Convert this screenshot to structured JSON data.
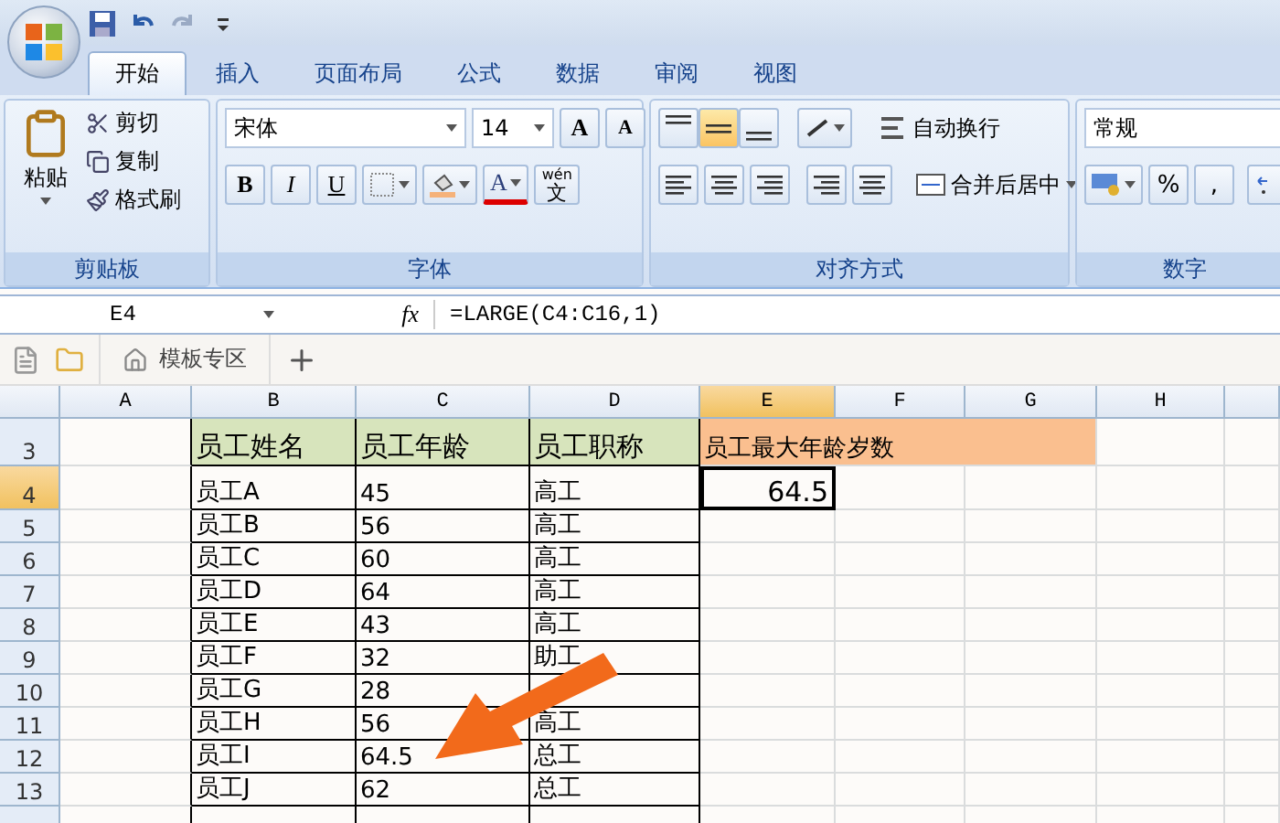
{
  "tabs": [
    {
      "label": "开始",
      "selected": true
    },
    {
      "label": "插入",
      "selected": false
    },
    {
      "label": "页面布局",
      "selected": false
    },
    {
      "label": "公式",
      "selected": false
    },
    {
      "label": "数据",
      "selected": false
    },
    {
      "label": "审阅",
      "selected": false
    },
    {
      "label": "视图",
      "selected": false
    }
  ],
  "clipboard": {
    "title": "剪贴板",
    "paste": "粘贴",
    "items": [
      "剪切",
      "复制",
      "格式刷"
    ]
  },
  "font": {
    "title": "字体",
    "name": "宋体",
    "size": "14",
    "grow": "A",
    "shrink": "A",
    "styles": [
      "B",
      "I",
      "U"
    ],
    "color_letter": "A",
    "phonetic_top": "wén",
    "phonetic_char": "文"
  },
  "alignment": {
    "title": "对齐方式",
    "vertical": [
      {
        "selected": false
      },
      {
        "selected": true
      },
      {
        "selected": false
      }
    ],
    "wrap": "自动换行",
    "merge": "合并后居中"
  },
  "number": {
    "title": "数字",
    "format": "常规",
    "symbols": [
      "%",
      ","
    ]
  },
  "formula_bar": {
    "cell_ref": "E4",
    "fx": "fx",
    "formula": "=LARGE(C4:C16,1)"
  },
  "doc_tabs": [
    {
      "label": "模板专区"
    }
  ],
  "columns": [
    {
      "label": "A",
      "selected": false
    },
    {
      "label": "B",
      "selected": false
    },
    {
      "label": "C",
      "selected": false
    },
    {
      "label": "D",
      "selected": false
    },
    {
      "label": "E",
      "selected": true
    },
    {
      "label": "F",
      "selected": false
    },
    {
      "label": "G",
      "selected": false
    },
    {
      "label": "H",
      "selected": false
    }
  ],
  "rows": [
    {
      "number": "3",
      "selected": false,
      "cells": [
        null,
        {
          "text": "员工姓名",
          "kind": "header",
          "color": "#d7e4bc"
        },
        {
          "text": "员工年龄",
          "kind": "header",
          "color": "#d7e4bc"
        },
        {
          "text": "员工职称",
          "kind": "header",
          "color": "#d7e4bc"
        },
        {
          "text": "员工最大年龄岁数",
          "kind": "wide-header",
          "color": "#fabf8f"
        }
      ]
    },
    {
      "number": "4",
      "selected": true,
      "cells": [
        null,
        {
          "text": "员工A",
          "kind": "data"
        },
        {
          "text": "45",
          "kind": "data"
        },
        {
          "text": "高工",
          "kind": "data"
        },
        {
          "text": "64.5",
          "kind": "result",
          "selected": true
        }
      ]
    },
    {
      "number": "5",
      "selected": false,
      "cells": [
        null,
        {
          "text": "员工B",
          "kind": "data"
        },
        {
          "text": "56",
          "kind": "data"
        },
        {
          "text": "高工",
          "kind": "data"
        }
      ]
    },
    {
      "number": "6",
      "selected": false,
      "cells": [
        null,
        {
          "text": "员工C",
          "kind": "data"
        },
        {
          "text": "60",
          "kind": "data"
        },
        {
          "text": "高工",
          "kind": "data"
        }
      ]
    },
    {
      "number": "7",
      "selected": false,
      "cells": [
        null,
        {
          "text": "员工D",
          "kind": "data"
        },
        {
          "text": "64",
          "kind": "data"
        },
        {
          "text": "高工",
          "kind": "data"
        }
      ]
    },
    {
      "number": "8",
      "selected": false,
      "cells": [
        null,
        {
          "text": "员工E",
          "kind": "data"
        },
        {
          "text": "43",
          "kind": "data"
        },
        {
          "text": "高工",
          "kind": "data"
        }
      ]
    },
    {
      "number": "9",
      "selected": false,
      "cells": [
        null,
        {
          "text": "员工F",
          "kind": "data"
        },
        {
          "text": "32",
          "kind": "data"
        },
        {
          "text": "助工",
          "kind": "data"
        }
      ]
    },
    {
      "number": "10",
      "selected": false,
      "cells": [
        null,
        {
          "text": "员工G",
          "kind": "data"
        },
        {
          "text": "28",
          "kind": "data"
        },
        {
          "text": "",
          "kind": "data"
        }
      ]
    },
    {
      "number": "11",
      "selected": false,
      "cells": [
        null,
        {
          "text": "员工H",
          "kind": "data"
        },
        {
          "text": "56",
          "kind": "data"
        },
        {
          "text": "高工",
          "kind": "data"
        }
      ]
    },
    {
      "number": "12",
      "selected": false,
      "cells": [
        null,
        {
          "text": "员工I",
          "kind": "data"
        },
        {
          "text": "64.5",
          "kind": "data"
        },
        {
          "text": "总工",
          "kind": "data"
        }
      ]
    },
    {
      "number": "13",
      "selected": false,
      "cells": [
        null,
        {
          "text": "员工J",
          "kind": "data"
        },
        {
          "text": "62",
          "kind": "data"
        },
        {
          "text": "总工",
          "kind": "data"
        }
      ]
    }
  ]
}
